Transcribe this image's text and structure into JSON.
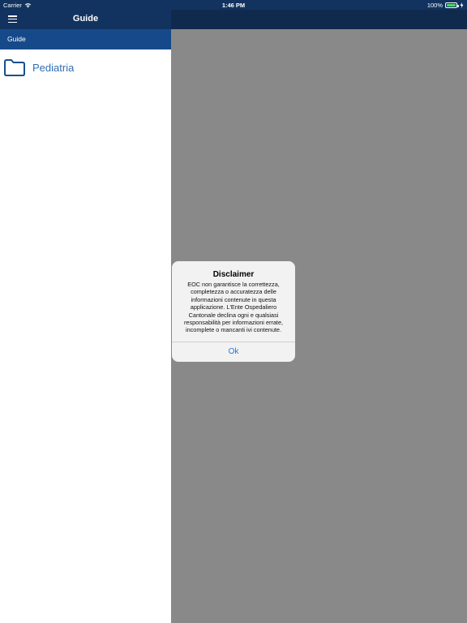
{
  "status_bar": {
    "carrier": "Carrier",
    "time": "1:46 PM",
    "battery_percent": "100%",
    "battery_level": 1.0,
    "battery_color": "#4cd964"
  },
  "sidebar": {
    "title": "Guide",
    "breadcrumb": "Guide",
    "menu_icon": "hamburger-menu-icon",
    "items": [
      {
        "label": "Pediatria",
        "icon": "folder-icon"
      }
    ]
  },
  "alert": {
    "title": "Disclaimer",
    "message": "EOC non garantisce la correttezza, completezza o accuratezza delle informazioni contenute in questa applicazione. L'Ente Ospedaliero Cantonale declina ogni e qualsiasi responsabilità per informazioni errate, incomplete o mancanti ivi contenute.",
    "ok_label": "Ok"
  },
  "colors": {
    "nav_bar": "#12335f",
    "breadcrumb_bar": "#16498a",
    "folder_accent": "#2f6fb5",
    "dimmed_background": "#898989",
    "alert_button": "#1e76d6"
  }
}
